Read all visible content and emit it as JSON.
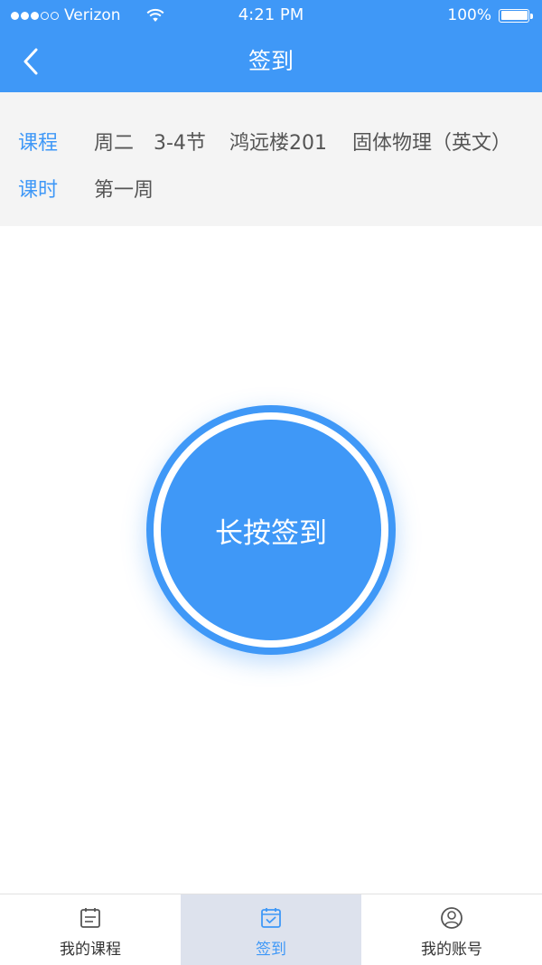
{
  "status_bar": {
    "carrier": "Verizon",
    "time": "4:21 PM",
    "battery": "100%",
    "battery_level": 1.0,
    "signal_bars": 3,
    "signal_total": 5
  },
  "nav": {
    "title": "签到",
    "back_icon": "chevron-left-icon"
  },
  "course": {
    "course_label": "课程",
    "day": "周二",
    "period": "3-4节",
    "room": "鸿远楼201",
    "name": "固体物理（英文）",
    "session_label": "课时",
    "week": "第一周"
  },
  "signin": {
    "label": "长按签到"
  },
  "tabs": [
    {
      "label": "我的课程",
      "icon": "list-icon",
      "active": false
    },
    {
      "label": "签到",
      "icon": "calendar-check-icon",
      "active": true
    },
    {
      "label": "我的账号",
      "icon": "user-circle-icon",
      "active": false
    }
  ],
  "colors": {
    "accent": "#3f98f7",
    "panel_bg": "#f4f4f4",
    "active_tab_bg": "#dde2ed"
  }
}
